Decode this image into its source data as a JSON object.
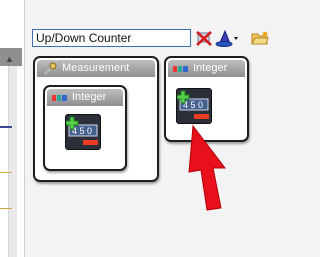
{
  "search": {
    "value": "Up/Down Counter"
  },
  "toolbar": {
    "clear_icon": "clear-search-icon",
    "wizard_icon": "wizard-hat-icon",
    "folder_icon": "folder-icon"
  },
  "blocks": {
    "measurement": {
      "title": "Measurement",
      "inner": {
        "title": "Integer"
      }
    },
    "integer": {
      "title": "Integer"
    }
  },
  "counter_digits": "4 5 0",
  "colors": {
    "title_bar": "#9d9d9d",
    "arrow": "#e8111b",
    "search_border": "#3f6fb8"
  }
}
